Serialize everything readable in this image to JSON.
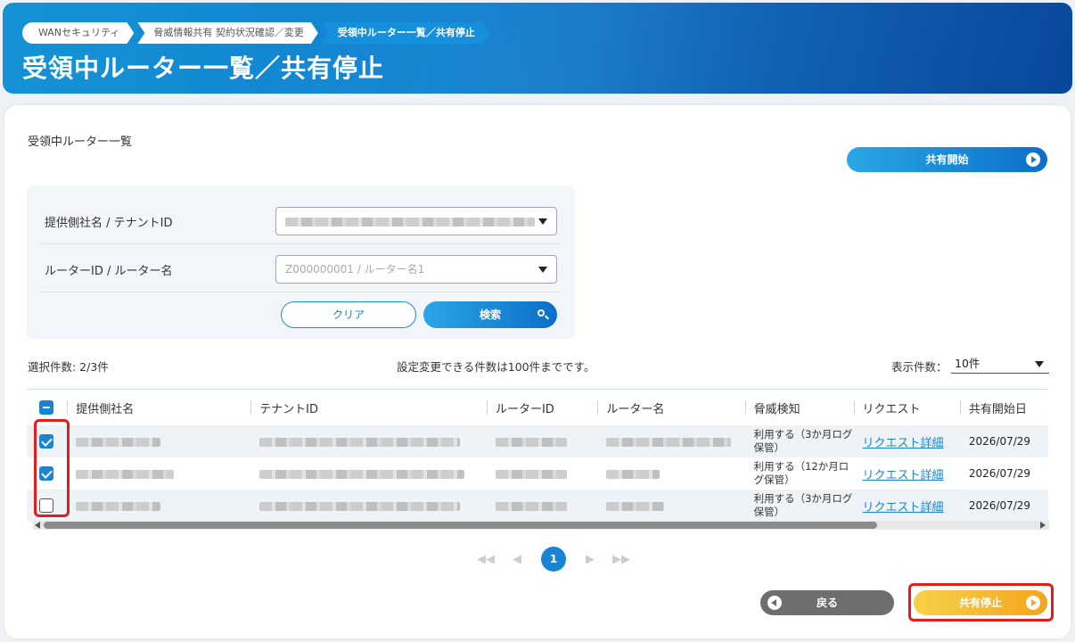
{
  "header": {
    "breadcrumb": [
      "WANセキュリティ",
      "脅威情報共有 契約状況確認／変更",
      "受領中ルーター一覧／共有停止"
    ],
    "title": "受領中ルーター一覧／共有停止"
  },
  "section_title": "受領中ルーター一覧",
  "share_start_label": "共有開始",
  "search": {
    "provider_label": "提供側社名 / テナントID",
    "router_label": "ルーターID / ルーター名",
    "router_placeholder": "Z000000001 / ルーター名1",
    "clear_label": "クリア",
    "search_label": "検索"
  },
  "info": {
    "selected": "選択件数: 2/3件",
    "limit_notice": "設定変更できる件数は100件までです。",
    "perpage_label": "表示件数：",
    "perpage_value": "10件"
  },
  "table": {
    "columns": [
      "提供側社名",
      "テナントID",
      "ルーターID",
      "ルーター名",
      "脅威検知",
      "リクエスト",
      "共有開始日"
    ],
    "rows": [
      {
        "checked": true,
        "threat": "利用する（3か月ログ保管）",
        "request": "リクエスト詳細",
        "date": "2026/07/29"
      },
      {
        "checked": true,
        "threat": "利用する（12か月ログ保管）",
        "request": "リクエスト詳細",
        "date": "2026/07/29"
      },
      {
        "checked": false,
        "threat": "利用する（3か月ログ保管）",
        "request": "リクエスト詳細",
        "date": "2026/07/29"
      }
    ]
  },
  "pager": {
    "current": "1"
  },
  "buttons": {
    "back": "戻る",
    "stop": "共有停止"
  },
  "colors": {
    "accent": "#1a84d4",
    "highlight": "#e01e1e",
    "stop": "#f3a51c"
  }
}
